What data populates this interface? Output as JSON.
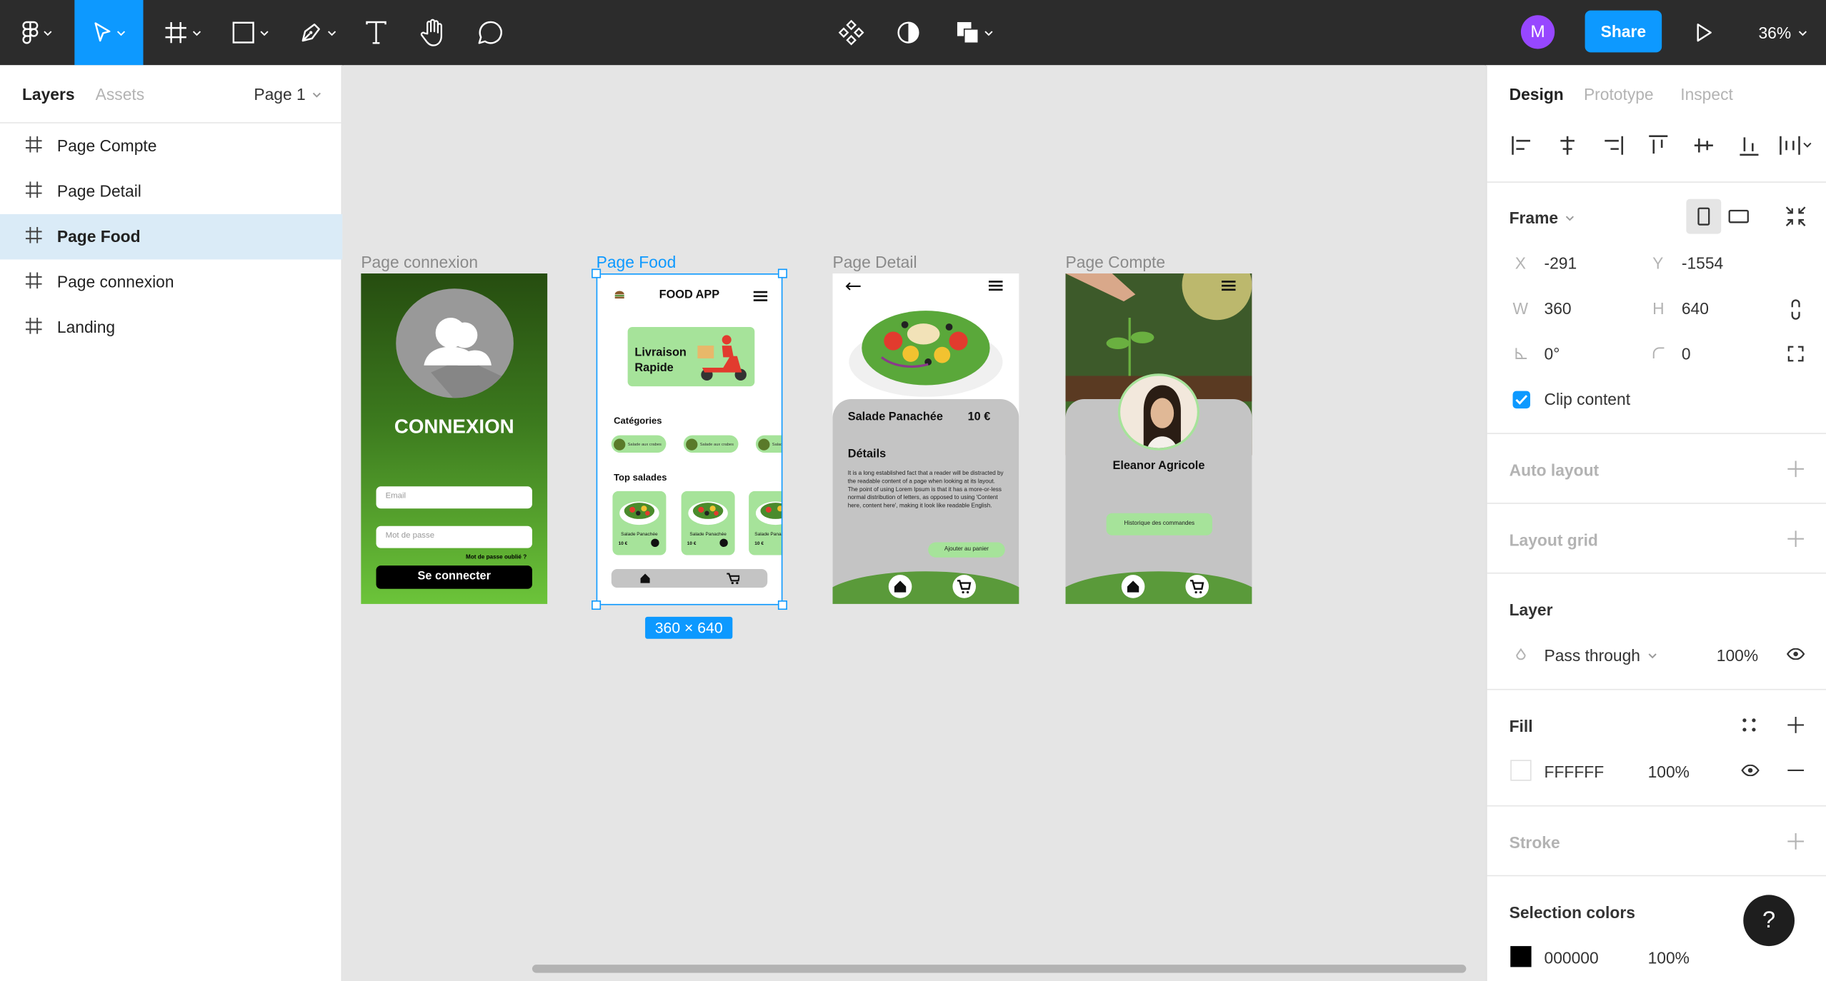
{
  "toolbar": {
    "share_label": "Share",
    "avatar_initial": "M",
    "zoom": "36%",
    "accent": "#0d99ff"
  },
  "left_panel": {
    "tabs": [
      "Layers",
      "Assets"
    ],
    "page_selector": "Page 1",
    "layers": [
      {
        "label": "Page Compte",
        "selected": false
      },
      {
        "label": "Page Detail",
        "selected": false
      },
      {
        "label": "Page Food",
        "selected": true
      },
      {
        "label": "Page connexion",
        "selected": false
      },
      {
        "label": "Landing",
        "selected": false
      }
    ]
  },
  "canvas": {
    "frames": [
      {
        "label": "Page connexion"
      },
      {
        "label": "Page Food"
      },
      {
        "label": "Page Detail"
      },
      {
        "label": "Page Compte"
      }
    ],
    "selection_size": "360 × 640",
    "connexion": {
      "title": "CONNEXION",
      "email_placeholder": "Email",
      "password_placeholder": "Mot de passe",
      "forgot": "Mot de passe oublié ?",
      "submit": "Se connecter"
    },
    "food": {
      "app_title": "FOOD APP",
      "banner": "Livraison Rapide",
      "categories_title": "Catégories",
      "category_chip": "Salade aux crabes",
      "top_title": "Top salades",
      "card_name": "Salade Panachée",
      "card_price": "10 €"
    },
    "detail": {
      "name": "Salade Panachée",
      "price": "10 €",
      "details_title": "Détails",
      "description": "It is a long established fact that a reader will be distracted by the readable content of a page when looking at its layout. The point of using Lorem Ipsum is that it has a more-or-less normal distribution of letters, as opposed to using 'Content here, content here', making it look like readable English.",
      "cta": "Ajouter au panier"
    },
    "compte": {
      "name": "Eleanor Agricole",
      "history": "Historique des commandes"
    }
  },
  "right_panel": {
    "tabs": [
      "Design",
      "Prototype",
      "Inspect"
    ],
    "frame": {
      "title": "Frame",
      "x": "-291",
      "y": "-1554",
      "w": "360",
      "h": "640",
      "rotation": "0°",
      "radius": "0",
      "clip_content": "Clip content"
    },
    "sections": {
      "auto_layout": "Auto layout",
      "layout_grid": "Layout grid",
      "layer": "Layer",
      "fill": "Fill",
      "stroke": "Stroke",
      "selection_colors": "Selection colors"
    },
    "layer": {
      "blend": "Pass through",
      "opacity": "100%"
    },
    "fill": {
      "hex": "FFFFFF",
      "opacity": "100%"
    },
    "selection_color": {
      "hex": "000000",
      "opacity": "100%"
    }
  },
  "help": "?"
}
